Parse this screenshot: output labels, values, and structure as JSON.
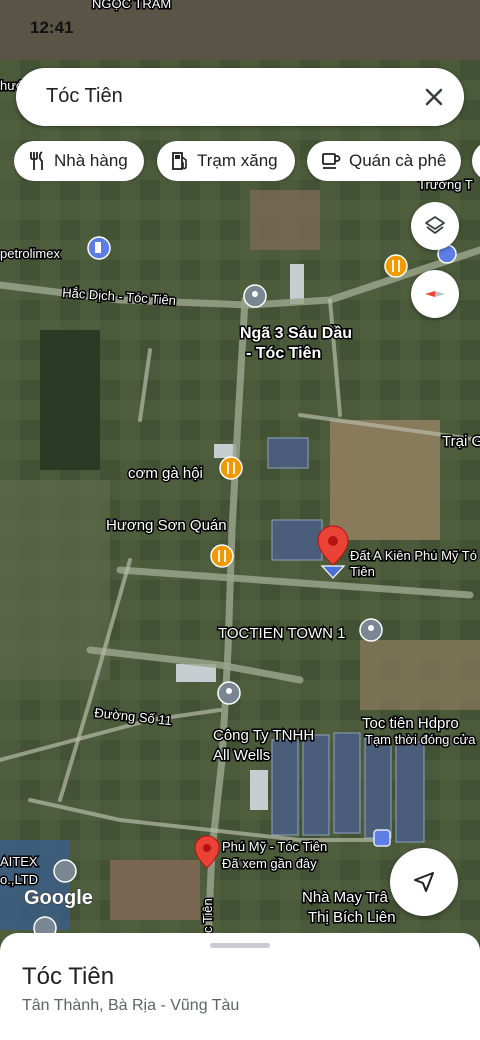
{
  "status_bar": {
    "time": "12:41"
  },
  "search": {
    "query": "Tóc Tiên"
  },
  "chips": [
    {
      "label": "Nhà hàng",
      "icon": "restaurant-icon"
    },
    {
      "label": "Trạm xăng",
      "icon": "gas-station-icon"
    },
    {
      "label": "Quán cà phê",
      "icon": "cafe-icon"
    }
  ],
  "map_labels": {
    "top_edge": "NGỌC TRÂM",
    "left_edge": "hước",
    "truong": "Trường T",
    "petrolimex": "petrolimex",
    "road_hac_dich": "Hắc Dịch - Tóc Tiên",
    "nga3_line1": "Ngã 3 Sáu Dầu",
    "nga3_line2": "- Tóc Tiên",
    "trai": "Trại G",
    "com_ga": "cơm gà hội",
    "huong_son": "Hương Sơn Quán",
    "dat_line1": "Đất A Kiên Phú Mỹ Tó",
    "dat_line2": "Tiên",
    "toctien_town": "TOCTIEN TOWN 1",
    "duong_so_11": "Đường Số 11",
    "cong_ty_line1": "Công Ty TNHH",
    "cong_ty_line2": "All Wells",
    "hdpro": "Toc tiên Hdpro",
    "hdpro_status": "Tạm thời đóng cửa",
    "phu_my": "Phú Mỹ - Tóc Tiên",
    "phu_my_sub": "Đã xem gần đây",
    "nha_may_line1": "Nhà May Trâ",
    "nha_may_line2": "Thị Bích Liên",
    "aitex_line1": "AITEX",
    "aitex_line2": "o.,LTD",
    "road_toc_tien": "c Tiên",
    "google": "Google"
  },
  "bottom_sheet": {
    "title": "Tóc Tiên",
    "subtitle": "Tân Thành, Bà Rịa - Vũng Tàu"
  },
  "colors": {
    "pin_red": "#ea4335",
    "poi_orange": "#f29900",
    "poi_gray": "#7a8692",
    "gas_blue": "#5c7ee6"
  }
}
